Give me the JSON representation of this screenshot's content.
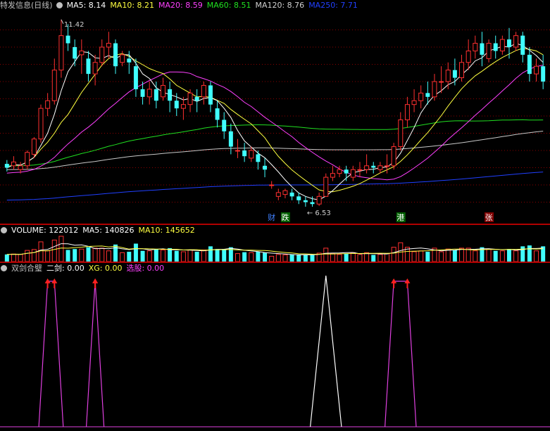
{
  "main": {
    "title": "特发信息(日线)",
    "indicators": [
      {
        "label": "MA5:",
        "value": "8.14",
        "color": "#ffffff"
      },
      {
        "label": "MA10:",
        "value": "8.21",
        "color": "#ffff40"
      },
      {
        "label": "MA20:",
        "value": "8.59",
        "color": "#ff40ff"
      },
      {
        "label": "MA60:",
        "value": "8.51",
        "color": "#20e020"
      },
      {
        "label": "MA120:",
        "value": "8.76",
        "color": "#d0d0d0"
      },
      {
        "label": "MA250:",
        "value": "7.71",
        "color": "#2040ff"
      }
    ],
    "high_label": "11.42",
    "low_label": "6.53",
    "badges": [
      {
        "text": "财",
        "color": "#4080ff",
        "bg": "#000000"
      },
      {
        "text": "跌",
        "color": "#ffffff",
        "bg": "#006000"
      },
      {
        "text": "港",
        "color": "#ffffff",
        "bg": "#006000"
      },
      {
        "text": "张",
        "color": "#ffffff",
        "bg": "#800000"
      }
    ]
  },
  "volume": {
    "indicators": [
      {
        "label": "VOLUME:",
        "value": "122012",
        "color": "#ffffff"
      },
      {
        "label": "MA5:",
        "value": "140826",
        "color": "#ffffff"
      },
      {
        "label": "MA10:",
        "value": "145652",
        "color": "#ffff40"
      }
    ]
  },
  "signal": {
    "indicators": [
      {
        "label": "双剑合璧",
        "value": "",
        "color": "#c0c0c0"
      },
      {
        "label": "二剑:",
        "value": "0.00",
        "color": "#ffffff"
      },
      {
        "label": "XG:",
        "value": "0.00",
        "color": "#ffff40"
      },
      {
        "label": "选股:",
        "value": "0.00",
        "color": "#ff40ff"
      }
    ]
  },
  "colors": {
    "up": "#ff3030",
    "down": "#40ffff",
    "ma5": "#ffffff",
    "ma10": "#ffff40",
    "ma20": "#ff40ff",
    "ma60": "#20e020",
    "ma120": "#c8c8c8",
    "ma250": "#2040ff",
    "grid": "#8b0000",
    "signal": "#e040e0",
    "arrow": "#ff2020"
  },
  "chart_data": [
    {
      "type": "candlestick",
      "title": "特发信息(日线)",
      "ylim": [
        6.2,
        11.6
      ],
      "candles": [
        [
          7.65,
          7.75,
          7.55,
          7.45
        ],
        [
          7.6,
          7.85,
          7.7,
          7.5
        ],
        [
          7.5,
          7.7,
          7.6,
          7.4
        ],
        [
          7.6,
          8.0,
          7.95,
          7.5
        ],
        [
          7.9,
          8.35,
          8.3,
          7.8
        ],
        [
          8.3,
          9.2,
          9.1,
          8.2
        ],
        [
          9.1,
          9.5,
          9.3,
          8.9
        ],
        [
          9.3,
          10.4,
          10.1,
          9.2
        ],
        [
          10.1,
          11.42,
          11.0,
          9.9
        ],
        [
          11.0,
          11.3,
          10.8,
          10.6
        ],
        [
          10.7,
          10.9,
          10.4,
          10.2
        ],
        [
          10.5,
          10.9,
          10.6,
          10.0
        ],
        [
          10.4,
          10.6,
          10.0,
          9.8
        ],
        [
          10.0,
          10.5,
          10.3,
          9.7
        ],
        [
          10.3,
          10.9,
          10.7,
          10.2
        ],
        [
          10.7,
          11.1,
          10.8,
          10.4
        ],
        [
          10.8,
          10.9,
          10.2,
          10.0
        ],
        [
          10.3,
          10.6,
          10.5,
          10.2
        ],
        [
          10.4,
          10.6,
          10.3,
          10.0
        ],
        [
          10.2,
          10.4,
          9.6,
          9.4
        ],
        [
          9.6,
          9.8,
          9.4,
          9.2
        ],
        [
          9.4,
          9.8,
          9.6,
          9.2
        ],
        [
          9.6,
          9.8,
          9.3,
          9.1
        ],
        [
          9.4,
          9.9,
          9.7,
          9.3
        ],
        [
          9.6,
          9.8,
          9.3,
          9.0
        ],
        [
          9.3,
          9.5,
          9.1,
          8.9
        ],
        [
          9.1,
          9.4,
          9.2,
          8.8
        ],
        [
          9.2,
          9.6,
          9.5,
          9.0
        ],
        [
          9.4,
          9.6,
          9.3,
          9.0
        ],
        [
          9.4,
          9.8,
          9.7,
          9.2
        ],
        [
          9.7,
          9.8,
          9.2,
          9.0
        ],
        [
          9.1,
          9.3,
          8.8,
          8.6
        ],
        [
          8.8,
          9.0,
          8.5,
          8.3
        ],
        [
          8.5,
          8.7,
          8.1,
          7.9
        ],
        [
          8.0,
          8.3,
          8.0,
          7.8
        ],
        [
          8.0,
          8.2,
          7.85,
          7.7
        ],
        [
          7.8,
          8.1,
          8.0,
          7.7
        ],
        [
          7.9,
          8.0,
          7.7,
          7.5
        ],
        [
          7.6,
          7.8,
          7.5,
          7.3
        ],
        [
          7.1,
          7.2,
          7.1,
          7.0
        ],
        [
          6.8,
          7.0,
          6.9,
          6.7
        ],
        [
          6.85,
          7.0,
          6.95,
          6.75
        ],
        [
          6.9,
          7.0,
          6.8,
          6.7
        ],
        [
          6.8,
          6.9,
          6.7,
          6.6
        ],
        [
          6.7,
          6.8,
          6.65,
          6.53
        ],
        [
          6.65,
          6.8,
          6.6,
          6.53
        ],
        [
          6.6,
          6.9,
          6.8,
          6.55
        ],
        [
          6.8,
          7.4,
          7.3,
          6.8
        ],
        [
          7.3,
          7.6,
          7.4,
          7.2
        ],
        [
          7.4,
          7.6,
          7.5,
          7.3
        ],
        [
          7.5,
          7.6,
          7.4,
          7.2
        ],
        [
          7.3,
          7.6,
          7.5,
          7.2
        ],
        [
          7.5,
          7.7,
          7.5,
          7.3
        ],
        [
          7.5,
          7.9,
          7.6,
          7.4
        ],
        [
          7.6,
          7.7,
          7.55,
          7.4
        ],
        [
          7.5,
          7.7,
          7.6,
          7.4
        ],
        [
          7.6,
          7.9,
          7.6,
          7.4
        ],
        [
          7.6,
          8.2,
          8.1,
          7.5
        ],
        [
          8.1,
          9.0,
          8.8,
          8.0
        ],
        [
          8.8,
          9.4,
          9.2,
          8.6
        ],
        [
          9.2,
          9.6,
          9.3,
          9.0
        ],
        [
          9.3,
          9.7,
          9.5,
          9.1
        ],
        [
          9.5,
          9.8,
          9.4,
          9.2
        ],
        [
          9.4,
          10.0,
          9.8,
          9.3
        ],
        [
          9.8,
          10.2,
          9.8,
          9.5
        ],
        [
          9.8,
          10.3,
          10.1,
          9.6
        ],
        [
          10.1,
          10.4,
          9.9,
          9.7
        ],
        [
          9.9,
          10.5,
          10.3,
          9.8
        ],
        [
          10.3,
          10.9,
          10.6,
          10.1
        ],
        [
          10.6,
          11.0,
          10.8,
          10.4
        ],
        [
          10.8,
          11.1,
          10.5,
          10.2
        ],
        [
          10.4,
          10.9,
          10.8,
          10.3
        ],
        [
          10.8,
          11.0,
          10.6,
          10.4
        ],
        [
          10.6,
          11.0,
          10.9,
          10.5
        ],
        [
          10.9,
          11.2,
          10.7,
          10.4
        ],
        [
          10.7,
          11.1,
          11.0,
          10.6
        ],
        [
          11.0,
          11.1,
          10.5,
          10.3
        ],
        [
          10.5,
          10.7,
          10.0,
          9.8
        ],
        [
          10.0,
          10.4,
          10.2,
          9.8
        ],
        [
          10.2,
          10.5,
          9.8,
          9.6
        ]
      ]
    },
    {
      "type": "bar",
      "title": "VOLUME",
      "ylim": [
        0,
        240000
      ]
    },
    {
      "type": "line",
      "title": "双剑合璧",
      "ylim": [
        0,
        1
      ],
      "signals": [
        {
          "type": "XG",
          "start": 5,
          "end": 8
        },
        {
          "type": "XG",
          "start": 12,
          "end": 14
        },
        {
          "type": "二剑",
          "start": 45,
          "end": 49
        },
        {
          "type": "XG",
          "start": 56,
          "end": 60
        }
      ]
    }
  ]
}
